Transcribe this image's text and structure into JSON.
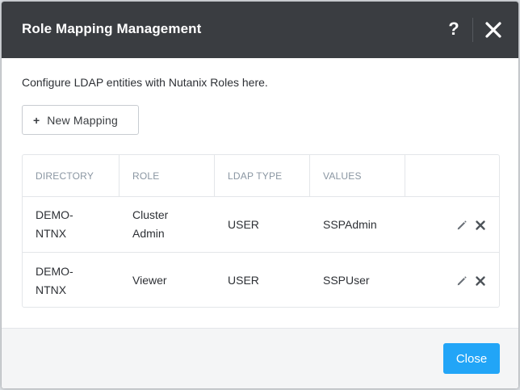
{
  "modal": {
    "title": "Role Mapping Management",
    "help_icon_glyph": "?",
    "description": "Configure LDAP entities with Nutanix Roles here.",
    "new_mapping_label": "New Mapping",
    "close_label": "Close",
    "accent_color": "#22a5f7"
  },
  "table": {
    "columns": [
      "DIRECTORY",
      "ROLE",
      "LDAP TYPE",
      "VALUES",
      ""
    ],
    "rows": [
      {
        "directory": [
          "DEMO-",
          "NTNX"
        ],
        "role": [
          "Cluster",
          "Admin"
        ],
        "ldap_type": "USER",
        "values": "SSPAdmin"
      },
      {
        "directory": [
          "DEMO-",
          "NTNX"
        ],
        "role": [
          "Viewer"
        ],
        "ldap_type": "USER",
        "values": "SSPUser"
      }
    ]
  },
  "icons": {
    "help": "question-mark-icon",
    "close": "close-x-icon",
    "add": "plus-icon",
    "edit": "pencil-icon",
    "delete": "x-icon"
  }
}
